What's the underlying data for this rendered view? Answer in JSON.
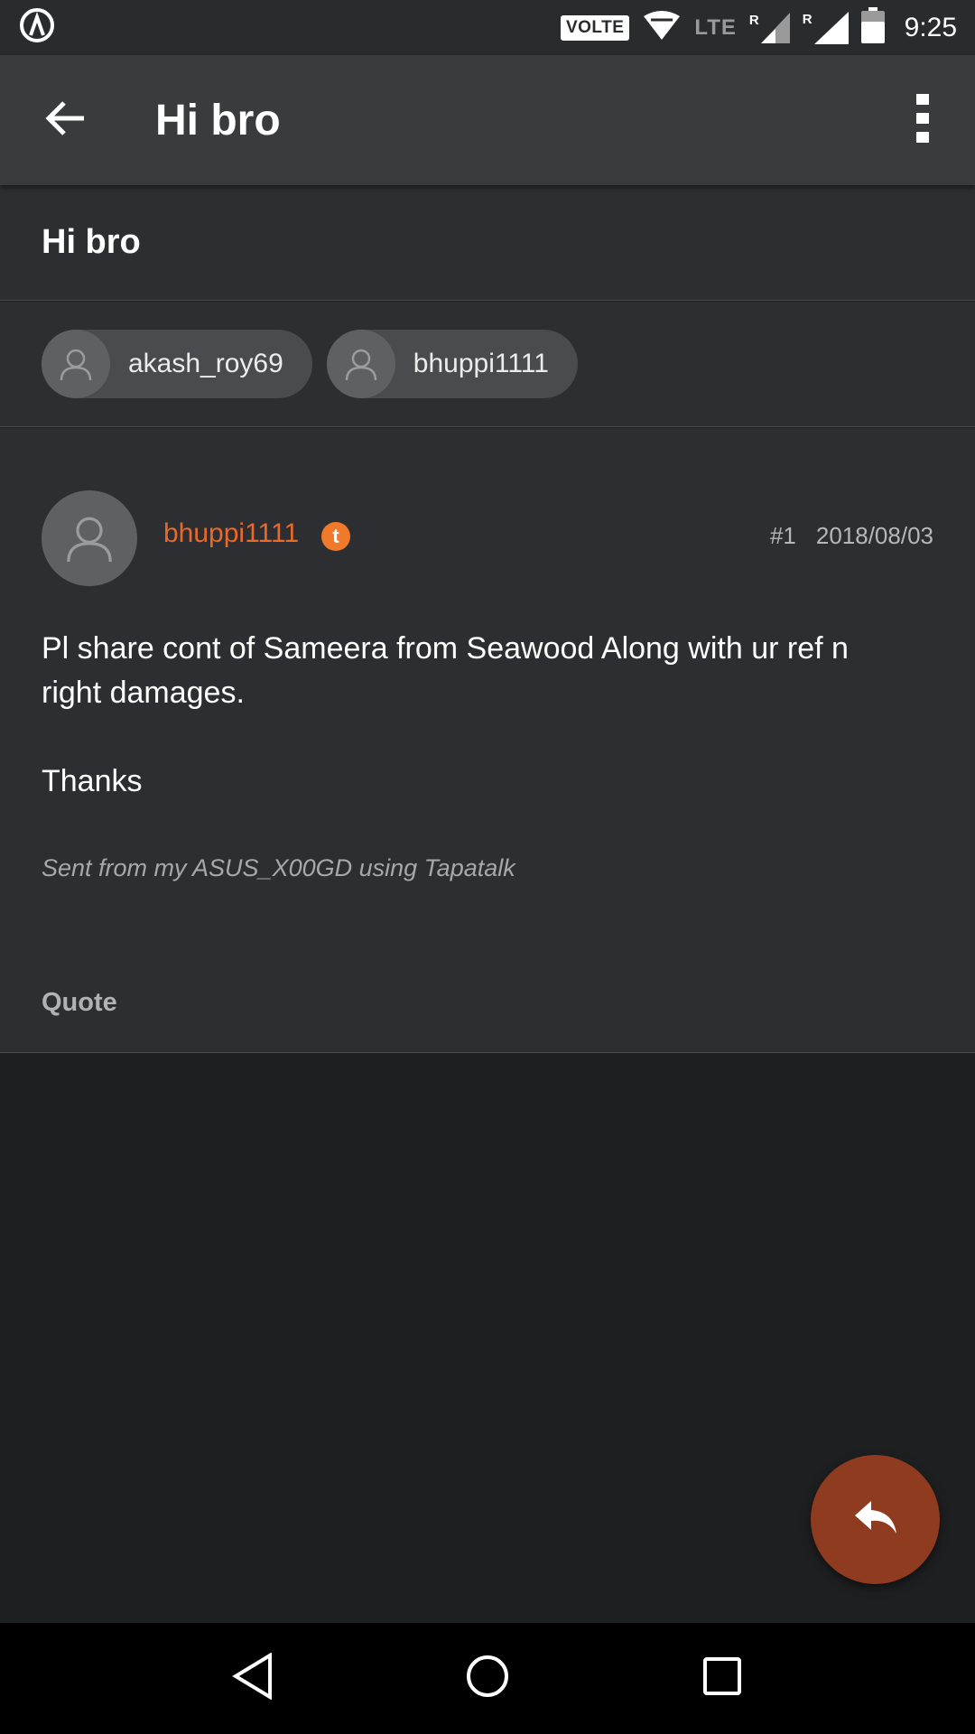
{
  "status_bar": {
    "volte_label": "VOLTE",
    "network_label": "LTE",
    "roaming_label": "R",
    "time": "9:25",
    "icons": [
      "app-notification-icon",
      "volte-icon",
      "wifi-icon",
      "signal-icon",
      "battery-icon"
    ]
  },
  "app_bar": {
    "title": "Hi bro",
    "back_icon": "arrow-left-icon",
    "more_icon": "more-vert-icon"
  },
  "thread": {
    "title": "Hi bro"
  },
  "participants": [
    {
      "name": "akash_roy69"
    },
    {
      "name": "bhuppi1111"
    }
  ],
  "post": {
    "author": "bhuppi1111",
    "badge": "t",
    "number": "#1",
    "date": "2018/08/03",
    "body_line1": "Pl share cont of Sameera from Seawood Along with ur ref n right damages.",
    "body_line2": "Thanks",
    "signature": "Sent from my ASUS_X00GD using Tapatalk",
    "quote_label": "Quote"
  },
  "fab": {
    "icon": "reply-icon"
  },
  "nav_bar": {
    "icons": [
      "nav-back-icon",
      "nav-home-icon",
      "nav-recents-icon"
    ]
  },
  "colors": {
    "accent": "#e8692a",
    "fab": "#8f3b1f",
    "app_bar": "#3a3b3d",
    "surface": "#2d2e31",
    "background": "#1e1f21"
  }
}
